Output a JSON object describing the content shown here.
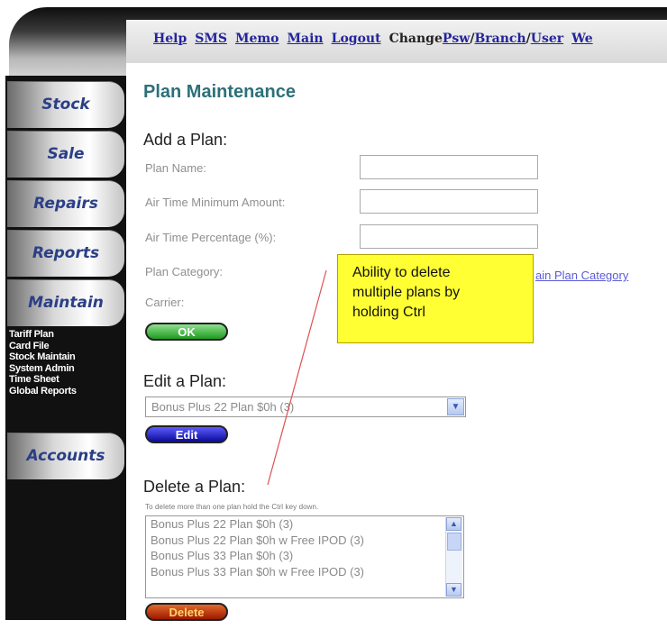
{
  "top_nav": {
    "links": [
      "Help",
      "SMS",
      "Memo",
      "Main",
      "Logout"
    ],
    "change_label": "Change",
    "change_links": [
      "Psw",
      "Branch",
      "User"
    ],
    "overflow_link": "We"
  },
  "sidebar": {
    "buttons": [
      "Stock",
      "Sale",
      "Repairs",
      "Reports",
      "Maintain",
      "Accounts"
    ],
    "submenu": [
      "Tariff Plan",
      "Card File",
      "Stock Maintain",
      "System Admin",
      "Time Sheet",
      "Global Reports"
    ]
  },
  "page": {
    "title": "Plan Maintenance",
    "add_heading": "Add a Plan:",
    "fields": [
      {
        "label": "Plan Name:"
      },
      {
        "label": "Air Time Minimum Amount:"
      },
      {
        "label": "Air Time Percentage (%):"
      },
      {
        "label": "Plan Category:"
      },
      {
        "label": "Carrier:"
      }
    ],
    "maintain_link": "ain Plan Category",
    "ok_button": "OK",
    "edit_heading": "Edit a Plan:",
    "edit_selected": "Bonus Plus 22 Plan $0h (3)",
    "edit_button": "Edit",
    "delete_heading": "Delete a Plan:",
    "delete_hint": "To delete more than one plan hold the Ctrl key down.",
    "delete_options": [
      "Bonus Plus 22 Plan $0h (3)",
      "Bonus Plus 22 Plan $0h w Free IPOD (3)",
      "Bonus Plus 33 Plan $0h (3)",
      "Bonus Plus 33 Plan $0h w Free IPOD (3)"
    ],
    "delete_button": "Delete"
  },
  "callout": {
    "lines": [
      "Ability to delete",
      "multiple plans by",
      "holding Ctrl"
    ]
  },
  "colors": {
    "title": "#2c7079",
    "nav_link": "#24249c",
    "callout_bg": "#ffff33",
    "ok_btn": "#1e9c1e",
    "edit_btn": "#0b0b9a",
    "delete_btn": "#9c1a00"
  },
  "icons": [
    "chevron-down-icon",
    "scroll-up-icon",
    "scroll-down-icon"
  ]
}
